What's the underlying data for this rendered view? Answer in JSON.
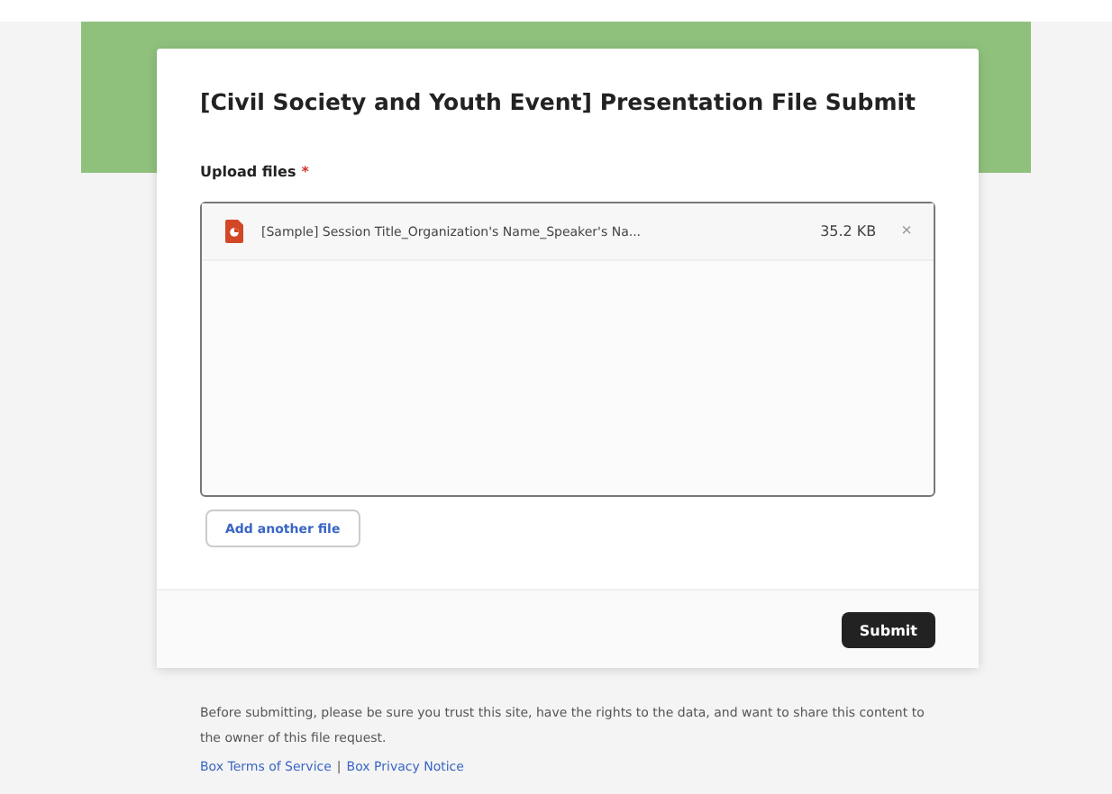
{
  "form": {
    "title": "[Civil Society and Youth Event] Presentation File Submit",
    "upload_label": "Upload files",
    "required_mark": "*",
    "files": [
      {
        "name": "[Sample] Session Title_Organization's Name_Speaker's Na...",
        "size": "35.2 KB",
        "remove": "×"
      }
    ],
    "add_button": "Add another file",
    "submit_button": "Submit"
  },
  "disclaimer": "Before submitting, please be sure you trust this site, have the rights to the data, and want to share this content to the owner of this file request.",
  "links": [
    {
      "label": "Box Terms of Service"
    },
    {
      "label": "Box Privacy Notice"
    }
  ],
  "link_separator": "|"
}
